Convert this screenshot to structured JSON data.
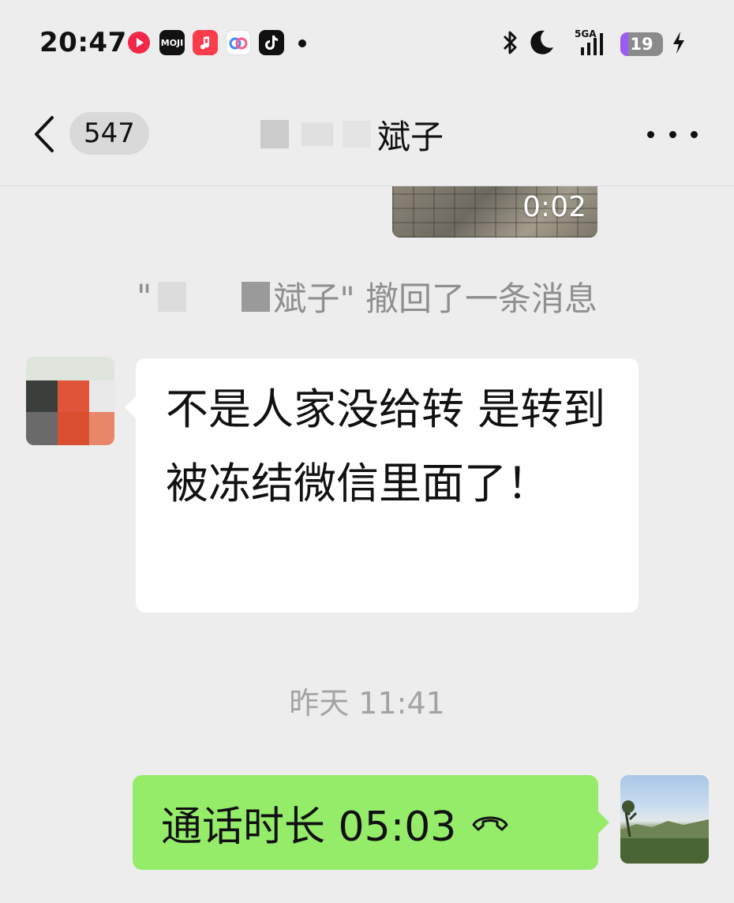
{
  "status_bar": {
    "time": "20:47",
    "network": "5GA",
    "battery": "19",
    "battery_level_percent": 19,
    "apps": [
      "video-app-icon",
      "moji-weather-icon",
      "music-app-icon",
      "baidu-netdisk-icon",
      "tiktok-icon"
    ],
    "moji_label": "MOJI"
  },
  "nav": {
    "unread_count": "547",
    "title_visible": "斌子"
  },
  "chat": {
    "video_duration": "0:02",
    "recall_notice": "斌子\" 撤回了一条消息",
    "incoming_message": "不是人家没给转 是转到被冻结微信里面了！",
    "timestamp": "昨天 11:41",
    "outgoing_call": "通话时长 05:03"
  },
  "colors": {
    "background": "#ededed",
    "incoming_bubble": "#ffffff",
    "outgoing_bubble": "#95ec69",
    "battery_accent": "#9b5cf5"
  }
}
